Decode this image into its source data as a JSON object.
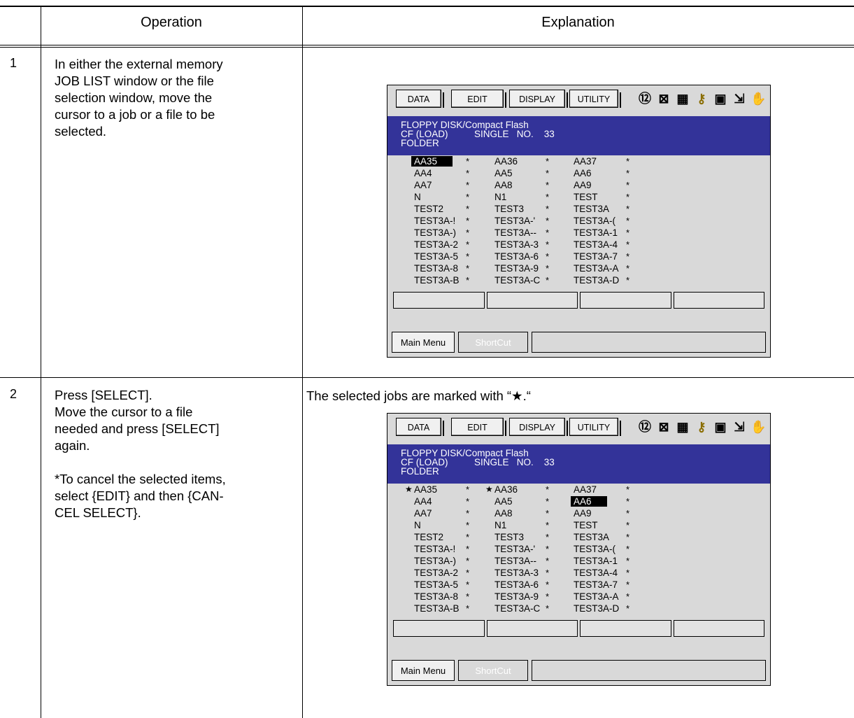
{
  "header": {
    "operation": "Operation",
    "explanation": "Explanation"
  },
  "steps": [
    {
      "number": "1",
      "lines": [
        "In either the external memory",
        "JOB LIST window or the file",
        "selection window, move the",
        "cursor to a job or a file to be",
        "selected."
      ]
    },
    {
      "number": "2",
      "lines": [
        "Press [SELECT].",
        "Move the cursor to a file",
        "needed and press [SELECT]",
        "again.",
        "",
        "*To cancel the selected items,",
        "select {EDIT} and then {CAN-",
        "CEL SELECT}."
      ],
      "note": "The selected jobs are marked with “★.“"
    }
  ],
  "screen": {
    "menu": [
      "DATA",
      "EDIT",
      "DISPLAY",
      "UTILITY"
    ],
    "icons": [
      "mode-icon",
      "step-icon",
      "teach-icon",
      "key-icon",
      "program-icon",
      "output-icon",
      "hand-icon"
    ],
    "title_line1": "FLOPPY DISK/Compact Flash",
    "title_line2": "CF (LOAD)          SINGLE   NO.    33",
    "title_line3": "FOLDER",
    "main_menu": "Main Menu",
    "shortcut": "ShortCut",
    "colors": {
      "title_bg": "#333399",
      "screen_bg": "#d9d9d9"
    }
  },
  "screen1": {
    "cursor": "AA35",
    "selected": [],
    "rows": [
      [
        "AA35",
        "AA36",
        "AA37"
      ],
      [
        "AA4",
        "AA5",
        "AA6"
      ],
      [
        "AA7",
        "AA8",
        "AA9"
      ],
      [
        "N",
        "N1",
        "TEST"
      ],
      [
        "TEST2",
        "TEST3",
        "TEST3A"
      ],
      [
        "TEST3A-!",
        "TEST3A-'",
        "TEST3A-("
      ],
      [
        "TEST3A-)",
        "TEST3A--",
        "TEST3A-1"
      ],
      [
        "TEST3A-2",
        "TEST3A-3",
        "TEST3A-4"
      ],
      [
        "TEST3A-5",
        "TEST3A-6",
        "TEST3A-7"
      ],
      [
        "TEST3A-8",
        "TEST3A-9",
        "TEST3A-A"
      ],
      [
        "TEST3A-B",
        "TEST3A-C",
        "TEST3A-D"
      ]
    ]
  },
  "screen2": {
    "cursor": "AA6",
    "selected": [
      "AA35",
      "AA36"
    ],
    "rows": [
      [
        "AA35",
        "AA36",
        "AA37"
      ],
      [
        "AA4",
        "AA5",
        "AA6"
      ],
      [
        "AA7",
        "AA8",
        "AA9"
      ],
      [
        "N",
        "N1",
        "TEST"
      ],
      [
        "TEST2",
        "TEST3",
        "TEST3A"
      ],
      [
        "TEST3A-!",
        "TEST3A-'",
        "TEST3A-("
      ],
      [
        "TEST3A-)",
        "TEST3A--",
        "TEST3A-1"
      ],
      [
        "TEST3A-2",
        "TEST3A-3",
        "TEST3A-4"
      ],
      [
        "TEST3A-5",
        "TEST3A-6",
        "TEST3A-7"
      ],
      [
        "TEST3A-8",
        "TEST3A-9",
        "TEST3A-A"
      ],
      [
        "TEST3A-B",
        "TEST3A-C",
        "TEST3A-D"
      ]
    ]
  }
}
